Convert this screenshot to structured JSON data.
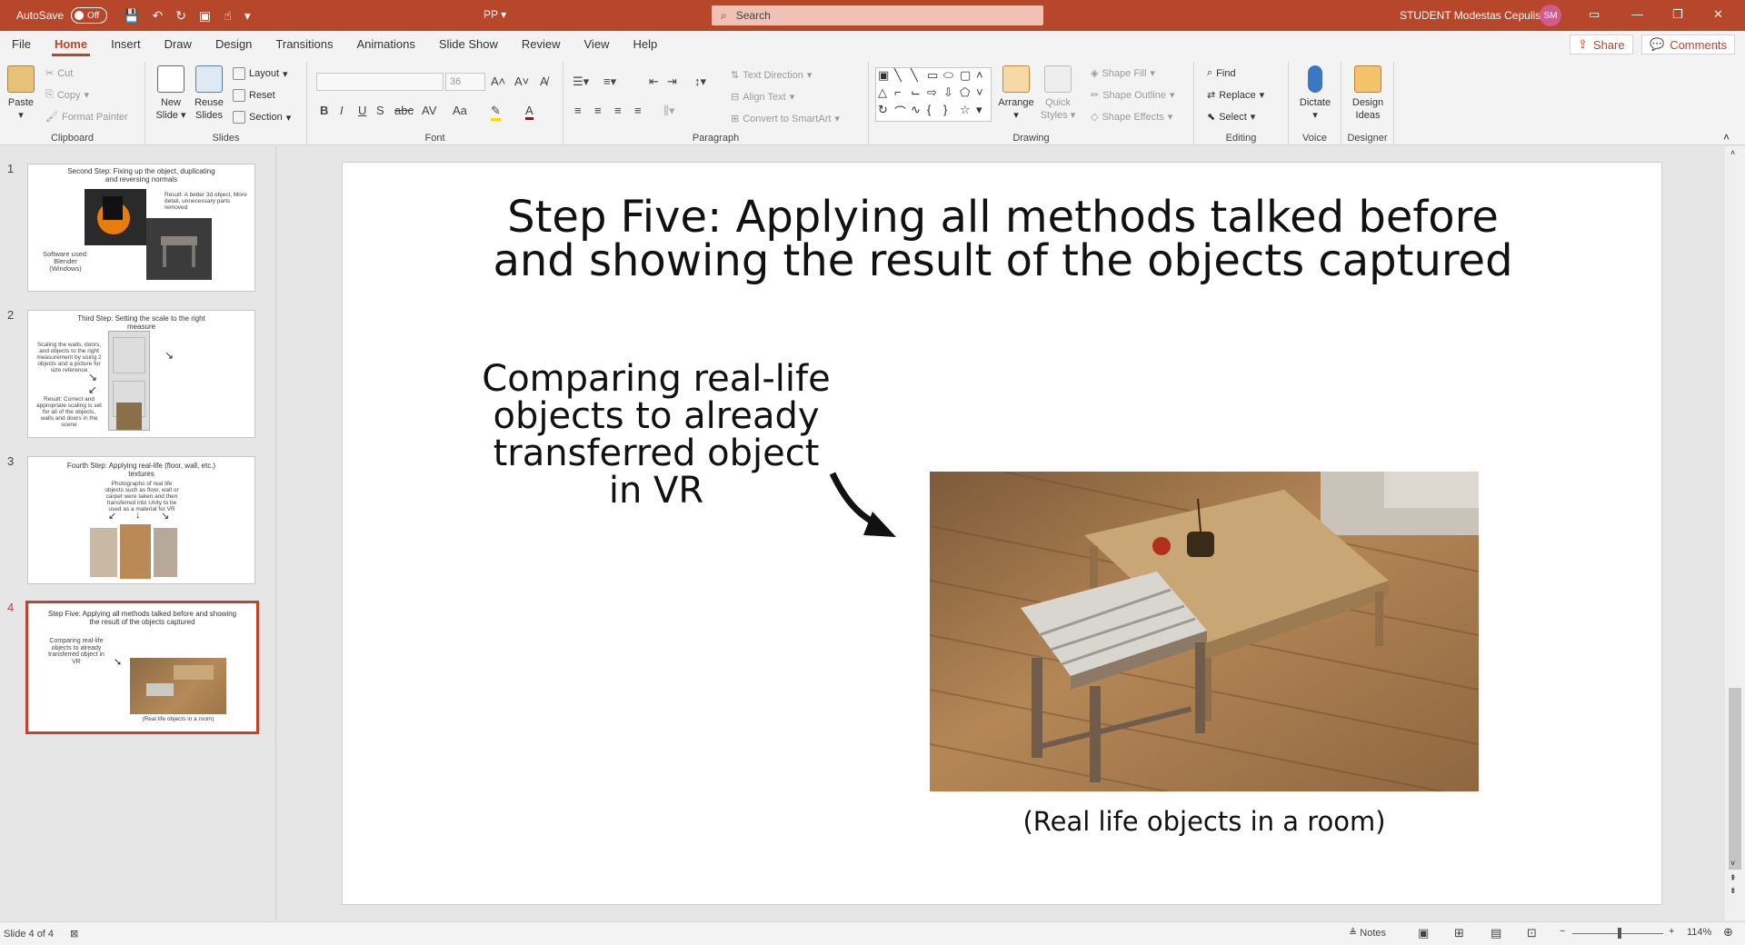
{
  "titlebar": {
    "autosave_label": "AutoSave",
    "autosave_state": "Off",
    "doc_title": "PP",
    "search_placeholder": "Search",
    "user_name": "STUDENT Modestas Cepulis",
    "user_initials": "SM"
  },
  "tabs": [
    "File",
    "Home",
    "Insert",
    "Draw",
    "Design",
    "Transitions",
    "Animations",
    "Slide Show",
    "Review",
    "View",
    "Help"
  ],
  "share_label": "Share",
  "comments_label": "Comments",
  "ribbon": {
    "clipboard": {
      "label": "Clipboard",
      "paste": "Paste",
      "cut": "Cut",
      "copy": "Copy",
      "format_painter": "Format Painter"
    },
    "slides": {
      "label": "Slides",
      "new_slide_1": "New",
      "new_slide_2": "Slide",
      "reuse_1": "Reuse",
      "reuse_2": "Slides",
      "layout": "Layout",
      "reset": "Reset",
      "section": "Section"
    },
    "font": {
      "label": "Font",
      "size": "36"
    },
    "paragraph": {
      "label": "Paragraph",
      "text_direction": "Text Direction",
      "align_text": "Align Text",
      "convert_smartart": "Convert to SmartArt"
    },
    "drawing": {
      "label": "Drawing",
      "arrange": "Arrange",
      "quick_styles_1": "Quick",
      "quick_styles_2": "Styles",
      "shape_fill": "Shape Fill",
      "shape_outline": "Shape Outline",
      "shape_effects": "Shape Effects"
    },
    "editing": {
      "label": "Editing",
      "find": "Find",
      "replace": "Replace",
      "select": "Select"
    },
    "voice": {
      "label": "Voice",
      "dictate": "Dictate"
    },
    "designer": {
      "label": "Designer",
      "design_ideas_1": "Design",
      "design_ideas_2": "Ideas"
    }
  },
  "thumbnails": [
    {
      "number": "1",
      "title": "Second Step: Fixing up the object, duplicating and reversing normals",
      "note": "Result: A better 3d object, More detail, unnecessary parts removed",
      "side": "Software used: Blender (Windows)"
    },
    {
      "number": "2",
      "title": "Third Step: Setting the scale to the right measure",
      "note": "Scaling the walls, doors, and objects to the right measurement by using 2 objects and a picture for size reference",
      "side": "Result: Correct and appropriate scaling is set for all of the objects, walls and doors in the scene"
    },
    {
      "number": "3",
      "title": "Fourth Step: Applying real-life (floor, wall, etc.) textures",
      "note": "Photographs of real life objects such as floor, wall or carpet were taken and then transferred into Unity to be used as a material for VR"
    },
    {
      "number": "4",
      "title": "Step Five: Applying all methods talked before and showing the result of the objects captured",
      "note": "Comparing real-life objects to already transferred object in VR",
      "caption": "(Real life objects in a room)"
    }
  ],
  "slide": {
    "title_line1": "Step Five: Applying all methods talked before",
    "title_line2": "and showing the result of the objects captured",
    "side_line1": "Comparing real-life",
    "side_line2": "objects to already",
    "side_line3": "transferred object",
    "side_line4": "in VR",
    "caption": "(Real life objects in a room)"
  },
  "status": {
    "slide_of": "Slide 4 of 4",
    "notes": "Notes",
    "zoom": "114%"
  },
  "colors": {
    "accent": "#b7472a",
    "selection": "#c3422a"
  }
}
